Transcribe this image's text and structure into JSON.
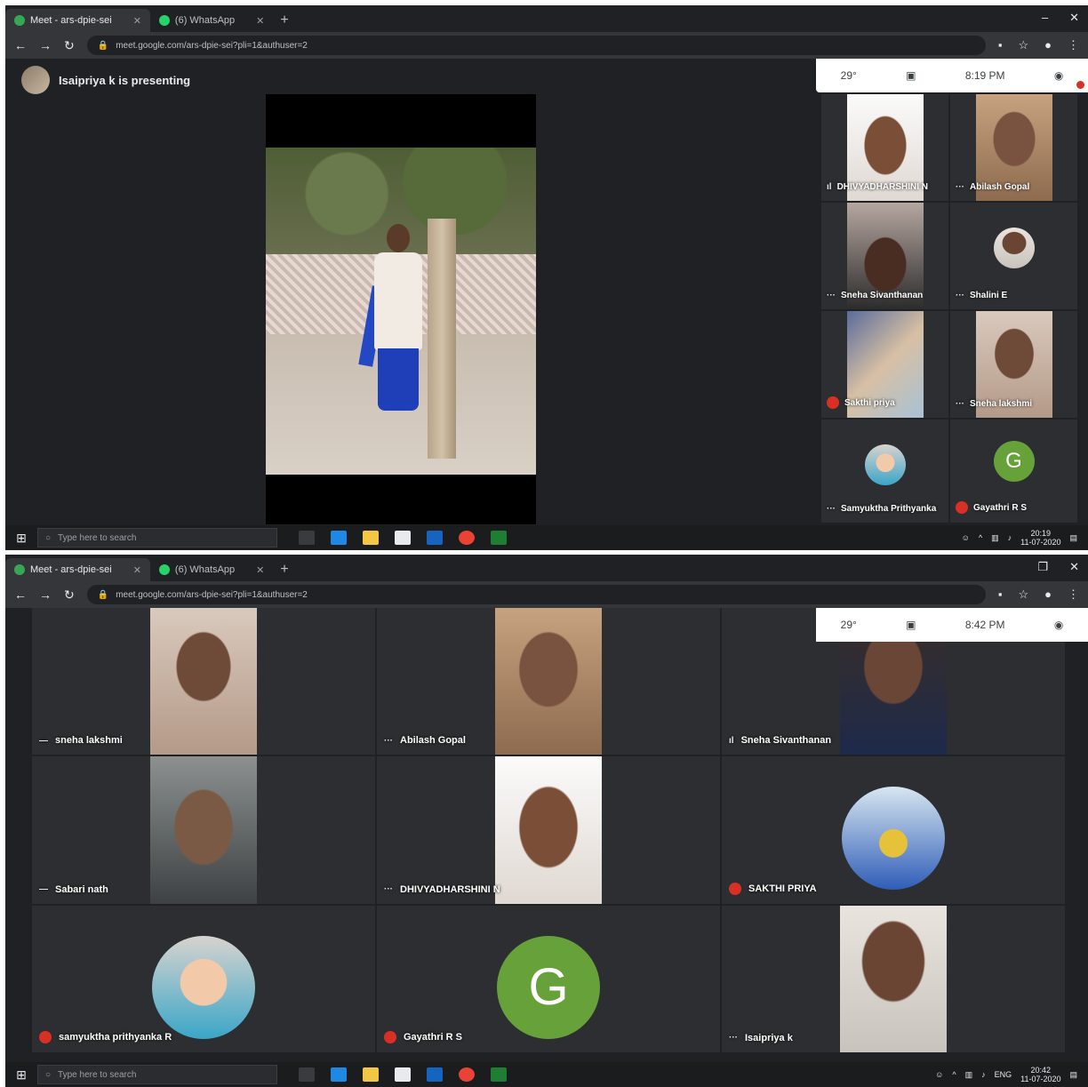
{
  "shot1": {
    "tabs": [
      {
        "label": "Meet - ars-dpie-sei",
        "active": true
      },
      {
        "label": "(6) WhatsApp",
        "active": false
      }
    ],
    "url": "meet.google.com/ars-dpie-sei?pli=1&authuser=2",
    "presenter_text": "Isaipriya k is presenting",
    "panel": {
      "temp": "29°",
      "time": "8:19 PM"
    },
    "participants": [
      {
        "name": "DHIVYADHARSHINI N",
        "indicator": "speaking"
      },
      {
        "name": "Abilash Gopal",
        "indicator": "dots"
      },
      {
        "name": "Sneha Sivanthanan",
        "indicator": "dots"
      },
      {
        "name": "Shalini E",
        "indicator": "dots"
      },
      {
        "name": "Sakthi priya",
        "indicator": "muted"
      },
      {
        "name": "Sneha lakshmi",
        "indicator": "dots"
      },
      {
        "name": "Samyuktha Prithyanka",
        "indicator": "dots"
      },
      {
        "name": "Gayathri R S",
        "indicator": "muted"
      }
    ],
    "taskbar": {
      "search_placeholder": "Type here to search",
      "time": "20:19",
      "date": "11-07-2020"
    }
  },
  "shot2": {
    "tabs": [
      {
        "label": "Meet - ars-dpie-sei",
        "active": true
      },
      {
        "label": "(6) WhatsApp",
        "active": false
      }
    ],
    "url": "meet.google.com/ars-dpie-sei?pli=1&authuser=2",
    "panel": {
      "temp": "29°",
      "time": "8:42 PM"
    },
    "participants": [
      {
        "name": "sneha lakshmi",
        "indicator": "dots"
      },
      {
        "name": "Abilash Gopal",
        "indicator": "dots"
      },
      {
        "name": "Sneha Sivanthanan",
        "indicator": "speaking"
      },
      {
        "name": "Sabari nath",
        "indicator": "dots"
      },
      {
        "name": "DHIVYADHARSHINI N",
        "indicator": "dots"
      },
      {
        "name": "SAKTHI PRIYA",
        "indicator": "muted"
      },
      {
        "name": "samyuktha prithyanka R",
        "indicator": "muted"
      },
      {
        "name": "Gayathri R S",
        "indicator": "muted"
      },
      {
        "name": "Isaipriya k",
        "indicator": "dots"
      }
    ],
    "letter_avatar": "G",
    "taskbar": {
      "search_placeholder": "Type here to search",
      "lang": "ENG",
      "time": "20:42",
      "date": "11-07-2020"
    }
  },
  "colors": {
    "meet_bg": "#202124",
    "tile_bg": "#2d2e31",
    "muted_red": "#d93025",
    "avatar_green": "#66a139"
  }
}
